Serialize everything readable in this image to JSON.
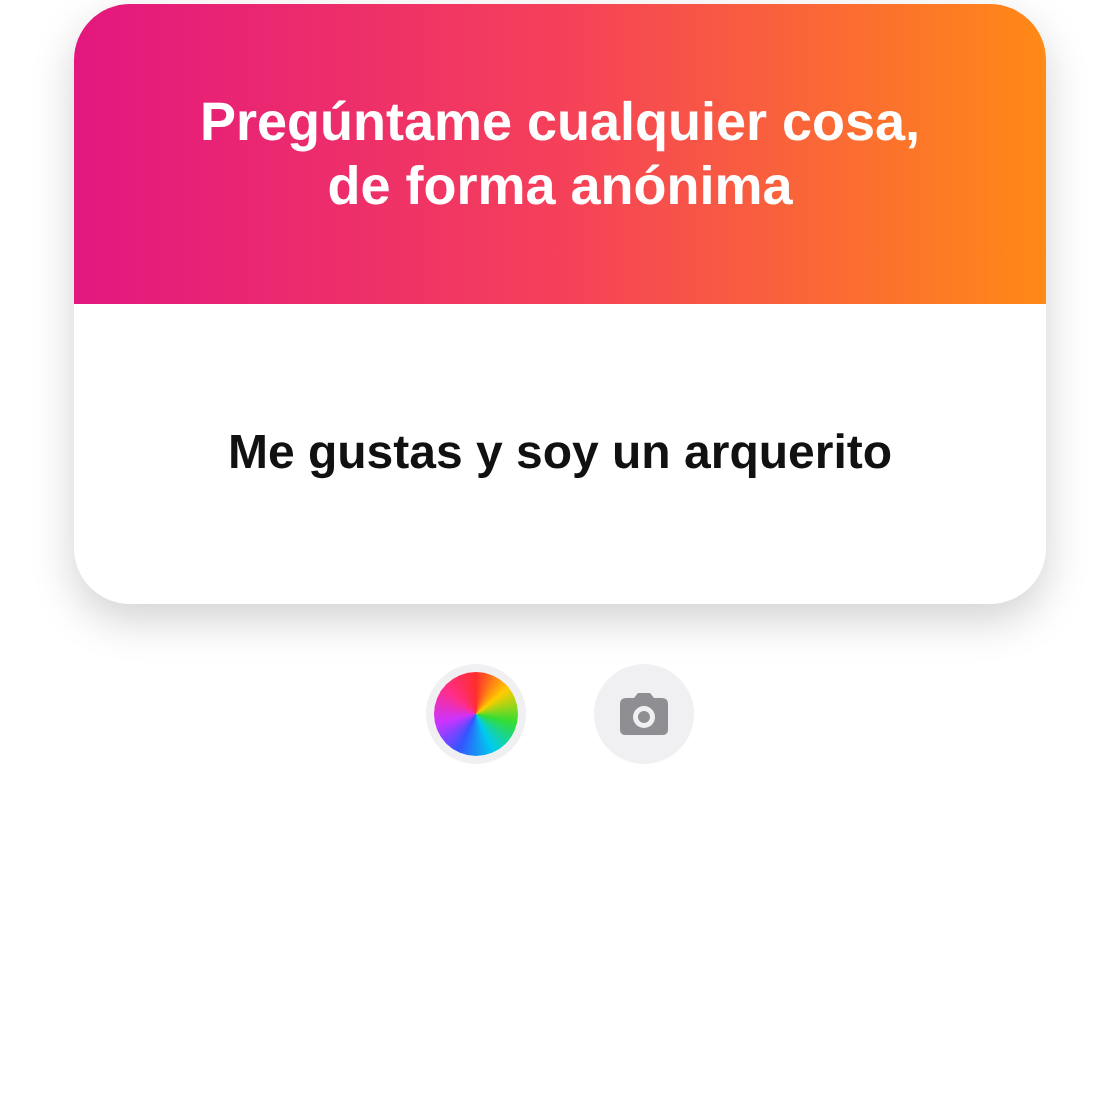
{
  "card": {
    "title": "Pregúntame cualquier cosa, de forma anónima",
    "answer": "Me gustas y soy un arquerito"
  },
  "tools": [
    {
      "kind": "color"
    },
    {
      "kind": "camera"
    }
  ]
}
